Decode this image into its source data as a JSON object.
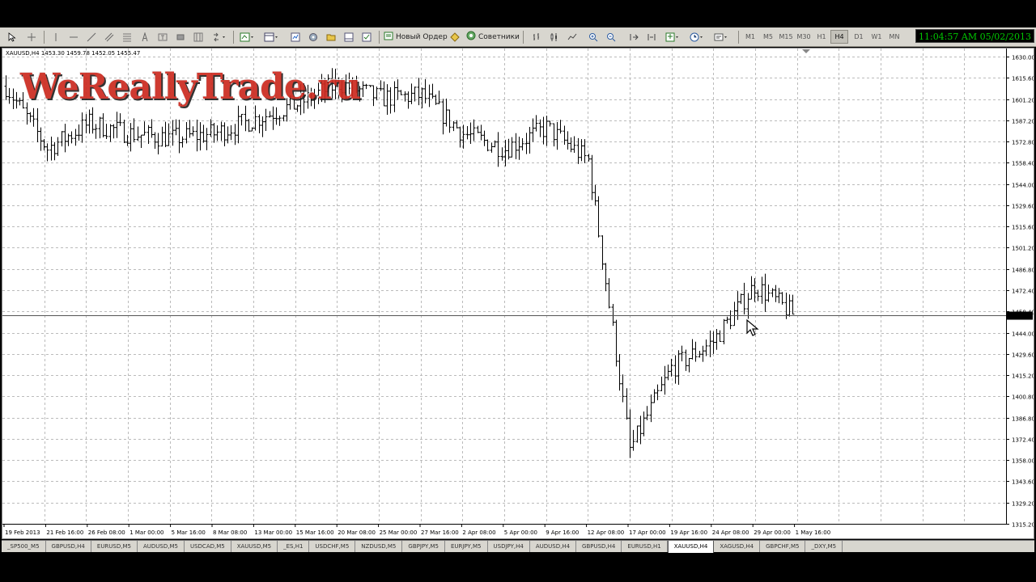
{
  "toolbar": {
    "new_order_label": "Новый Ордер",
    "experts_label": "Советники",
    "timeframes": [
      "M1",
      "M5",
      "M15",
      "M30",
      "H1",
      "H4",
      "D1",
      "W1",
      "MN"
    ],
    "active_timeframe": "H4"
  },
  "clock": "11:04:57 AM 05/02/2013",
  "chart": {
    "symbol_info": "XAUUSD,H4  1453.30 1459.78 1452.05 1455.47",
    "watermark": "WeReallyTrade.ru",
    "current_price_label": "1455.47",
    "price_axis": [
      "1630.00",
      "1615.60",
      "1601.20",
      "1587.20",
      "1572.80",
      "1558.40",
      "1544.00",
      "1529.60",
      "1515.60",
      "1501.20",
      "1486.80",
      "1472.40",
      "1458.40",
      "1444.00",
      "1429.60",
      "1415.20",
      "1400.80",
      "1386.80",
      "1372.40",
      "1358.00",
      "1343.60",
      "1329.20",
      "1315.20"
    ],
    "time_axis": [
      "19 Feb 2013",
      "21 Feb 16:00",
      "26 Feb 08:00",
      "1 Mar 00:00",
      "5 Mar 16:00",
      "8 Mar 08:00",
      "13 Mar 00:00",
      "15 Mar 16:00",
      "20 Mar 08:00",
      "25 Mar 00:00",
      "27 Mar 16:00",
      "2 Apr 08:00",
      "5 Apr 00:00",
      "9 Apr 16:00",
      "12 Apr 08:00",
      "17 Apr 00:00",
      "19 Apr 16:00",
      "24 Apr 08:00",
      "29 Apr 00:00",
      "1 May 16:00"
    ]
  },
  "chart_data": {
    "type": "line",
    "title": "XAUUSD,H4",
    "ylim": [
      1315.2,
      1630.0
    ],
    "x": [
      "19 Feb 2013",
      "21 Feb 16:00",
      "26 Feb 08:00",
      "1 Mar 00:00",
      "5 Mar 16:00",
      "8 Mar 08:00",
      "13 Mar 00:00",
      "15 Mar 16:00",
      "20 Mar 08:00",
      "25 Mar 00:00",
      "27 Mar 16:00",
      "2 Apr 08:00",
      "5 Apr 00:00",
      "9 Apr 16:00",
      "12 Apr 08:00",
      "17 Apr 00:00",
      "19 Apr 16:00",
      "24 Apr 08:00",
      "29 Apr 00:00",
      "1 May 16:00"
    ],
    "series": [
      {
        "name": "XAUUSD,H4",
        "values": [
          1610,
          1568,
          1585,
          1578,
          1575,
          1578,
          1588,
          1598,
          1612,
          1602,
          1604,
          1578,
          1568,
          1582,
          1560,
          1365,
          1420,
          1438,
          1476,
          1455
        ]
      }
    ]
  },
  "tabs": [
    "_SP500_M5",
    "GBPUSD,H4",
    "EURUSD,M5",
    "AUDUSD,M5",
    "USDCAD,M5",
    "XAUUSD,M5",
    "_ES,H1",
    "USDCHF,M5",
    "NZDUSD,M5",
    "GBPJPY,M5",
    "EURJPY,M5",
    "USDJPY,H4",
    "AUDUSD,H4",
    "GBPUSD,H4",
    "EURUSD,H1",
    "XAUUSD,H4",
    "XAGUSD,H4",
    "GBPCHF,M5",
    "_DXY,M5"
  ],
  "active_tab": "XAUUSD,H4"
}
